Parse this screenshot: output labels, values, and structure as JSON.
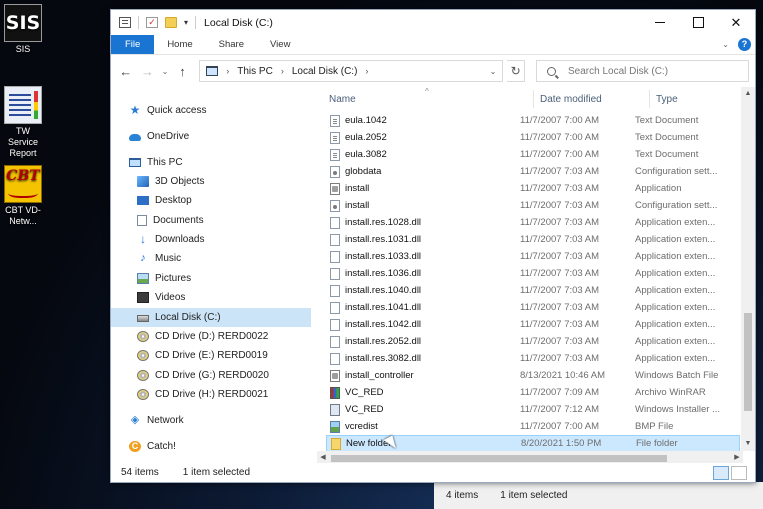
{
  "desktop": {
    "icons": [
      {
        "label": "SIS",
        "art": "SIS"
      },
      {
        "label": "TW Service Report",
        "art": ""
      },
      {
        "label": "CBT VD-Netw...",
        "art": "CBT"
      }
    ]
  },
  "background_window": {
    "status_items": "4 items",
    "status_selected": "1 item selected"
  },
  "window": {
    "title": "Local Disk (C:)",
    "qat_down_arrow": "▾",
    "controls": {
      "close": "✕"
    },
    "ribbon_tabs": [
      "File",
      "Home",
      "Share",
      "View"
    ],
    "ribbon_expand": "⌄",
    "help": "?",
    "nav": {
      "back": "←",
      "forward": "→",
      "recent": "⌄",
      "up": "↑",
      "address": [
        "This PC",
        "Local Disk (C:)"
      ],
      "address_sep": "›",
      "address_dropdown": "⌄",
      "refresh": "↻",
      "search_placeholder": "Search Local Disk (C:)"
    },
    "sidebar": {
      "items": [
        {
          "label": "Quick access",
          "icon": "star-icon"
        },
        {
          "label": "OneDrive",
          "icon": "cloud-icon"
        },
        {
          "label": "This PC",
          "icon": "pc-icon"
        },
        {
          "label": "3D Objects",
          "icon": "cube-icon"
        },
        {
          "label": "Desktop",
          "icon": "desktop-icon"
        },
        {
          "label": "Documents",
          "icon": "documents-icon"
        },
        {
          "label": "Downloads",
          "icon": "downloads-icon"
        },
        {
          "label": "Music",
          "icon": "music-icon"
        },
        {
          "label": "Pictures",
          "icon": "pictures-icon"
        },
        {
          "label": "Videos",
          "icon": "videos-icon"
        },
        {
          "label": "Local Disk (C:)",
          "icon": "drive-icon",
          "selected": true
        },
        {
          "label": "CD Drive (D:) RERD0022",
          "icon": "cd-icon"
        },
        {
          "label": "CD Drive (E:) RERD0019",
          "icon": "cd-icon"
        },
        {
          "label": "CD Drive (G:) RERD0020",
          "icon": "cd-icon"
        },
        {
          "label": "CD Drive (H:) RERD0021",
          "icon": "cd-icon"
        },
        {
          "label": "Network",
          "icon": "network-icon"
        },
        {
          "label": "Catch!",
          "icon": "catch-icon"
        }
      ]
    },
    "columns": {
      "name": "Name",
      "date": "Date modified",
      "type": "Type",
      "sort_caret": "^"
    },
    "files": [
      {
        "name": "eula.1042",
        "date": "11/7/2007 7:00 AM",
        "type": "Text Document",
        "kind": "text"
      },
      {
        "name": "eula.2052",
        "date": "11/7/2007 7:00 AM",
        "type": "Text Document",
        "kind": "text"
      },
      {
        "name": "eula.3082",
        "date": "11/7/2007 7:00 AM",
        "type": "Text Document",
        "kind": "text"
      },
      {
        "name": "globdata",
        "date": "11/7/2007 7:03 AM",
        "type": "Configuration sett...",
        "kind": "conf"
      },
      {
        "name": "install",
        "date": "11/7/2007 7:03 AM",
        "type": "Application",
        "kind": "app"
      },
      {
        "name": "install",
        "date": "11/7/2007 7:03 AM",
        "type": "Configuration sett...",
        "kind": "conf"
      },
      {
        "name": "install.res.1028.dll",
        "date": "11/7/2007 7:03 AM",
        "type": "Application exten...",
        "kind": "dll"
      },
      {
        "name": "install.res.1031.dll",
        "date": "11/7/2007 7:03 AM",
        "type": "Application exten...",
        "kind": "dll"
      },
      {
        "name": "install.res.1033.dll",
        "date": "11/7/2007 7:03 AM",
        "type": "Application exten...",
        "kind": "dll"
      },
      {
        "name": "install.res.1036.dll",
        "date": "11/7/2007 7:03 AM",
        "type": "Application exten...",
        "kind": "dll"
      },
      {
        "name": "install.res.1040.dll",
        "date": "11/7/2007 7:03 AM",
        "type": "Application exten...",
        "kind": "dll"
      },
      {
        "name": "install.res.1041.dll",
        "date": "11/7/2007 7:03 AM",
        "type": "Application exten...",
        "kind": "dll"
      },
      {
        "name": "install.res.1042.dll",
        "date": "11/7/2007 7:03 AM",
        "type": "Application exten...",
        "kind": "dll"
      },
      {
        "name": "install.res.2052.dll",
        "date": "11/7/2007 7:03 AM",
        "type": "Application exten...",
        "kind": "dll"
      },
      {
        "name": "install.res.3082.dll",
        "date": "11/7/2007 7:03 AM",
        "type": "Application exten...",
        "kind": "dll"
      },
      {
        "name": "install_controller",
        "date": "8/13/2021 10:46 AM",
        "type": "Windows Batch File",
        "kind": "app"
      },
      {
        "name": "VC_RED",
        "date": "11/7/2007 7:09 AM",
        "type": "Archivo WinRAR",
        "kind": "rar"
      },
      {
        "name": "VC_RED",
        "date": "11/7/2007 7:12 AM",
        "type": "Windows Installer ...",
        "kind": "msi"
      },
      {
        "name": "vcredist",
        "date": "11/7/2007 7:00 AM",
        "type": "BMP File",
        "kind": "bmp"
      },
      {
        "name": "New folder",
        "date": "8/20/2021 1:50 PM",
        "type": "File folder",
        "kind": "folder",
        "selected": true
      }
    ],
    "scroll": {
      "up": "▲",
      "down": "▼",
      "left": "◀",
      "right": "▶"
    },
    "status": {
      "items": "54 items",
      "selected": "1 item selected"
    }
  }
}
